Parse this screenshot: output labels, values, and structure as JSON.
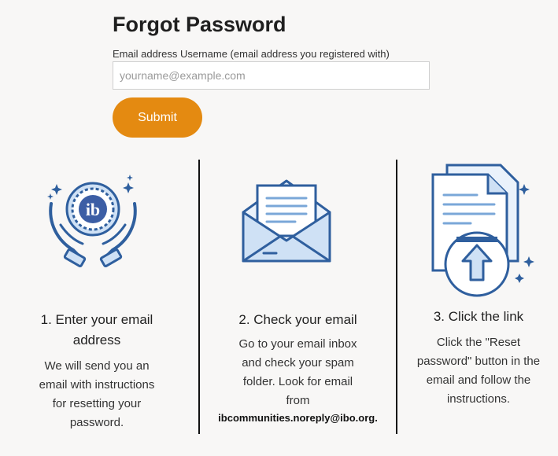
{
  "form": {
    "title": "Forgot Password",
    "email_label": "Email address Username (email address you registered with)",
    "email_placeholder": "yourname@example.com",
    "email_value": "",
    "submit_label": "Submit"
  },
  "steps": [
    {
      "icon": "hands-holding-ib-logo-icon",
      "title_line1": "1. Enter your email",
      "title_line2": "address",
      "desc_lines": [
        "We will send you an",
        "email with instructions",
        "for resetting your",
        "password."
      ]
    },
    {
      "icon": "open-envelope-icon",
      "title_line1": "2. Check your email",
      "desc_lines": [
        "Go to your email inbox",
        "and check your spam",
        "folder. Look for email",
        "from"
      ],
      "email": "ibcommunities.noreply@ibo.org."
    },
    {
      "icon": "document-upload-icon",
      "title_line1": "3. Click the link",
      "desc_lines": [
        "Click the \"Reset",
        "password\" button in the",
        "email and follow the",
        "instructions."
      ]
    }
  ],
  "colors": {
    "accent": "#e48a11",
    "icon_blue": "#2f5f9e",
    "icon_light": "#cfe1f5"
  }
}
